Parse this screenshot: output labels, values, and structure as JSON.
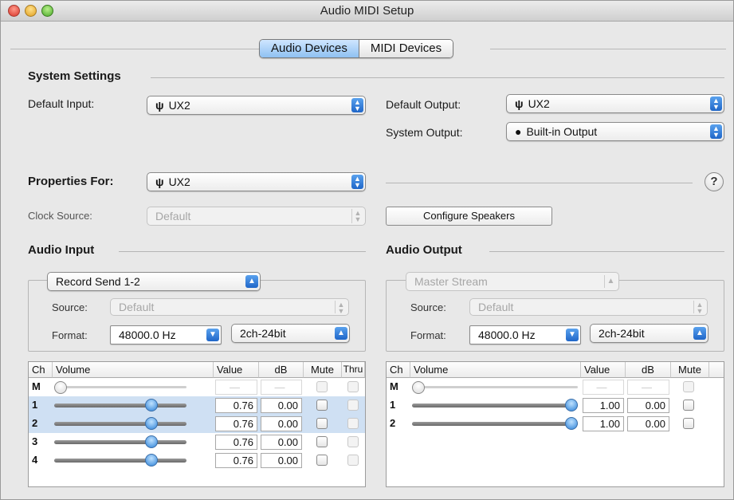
{
  "window": {
    "title": "Audio MIDI Setup"
  },
  "tabs": [
    {
      "label": "Audio Devices",
      "active": true
    },
    {
      "label": "MIDI Devices",
      "active": false
    }
  ],
  "system_settings": {
    "header": "System Settings",
    "default_input_label": "Default Input:",
    "default_input_value": "UX2",
    "default_output_label": "Default Output:",
    "default_output_value": "UX2",
    "system_output_label": "System Output:",
    "system_output_value": "Built-in Output"
  },
  "properties": {
    "label": "Properties For:",
    "value": "UX2",
    "help_label": "?",
    "clock_source_label": "Clock Source:",
    "clock_source_value": "Default",
    "configure_speakers_label": "Configure Speakers"
  },
  "audio_input": {
    "header": "Audio Input",
    "stream": "Record Send 1-2",
    "source_label": "Source:",
    "source_value": "Default",
    "format_label": "Format:",
    "rate": "48000.0 Hz",
    "bits": "2ch-24bit",
    "table": {
      "headers": {
        "ch": "Ch",
        "volume": "Volume",
        "value": "Value",
        "db": "dB",
        "mute": "Mute",
        "thru": "Thru"
      },
      "rows": [
        {
          "ch": "M",
          "value": "—",
          "db": "—",
          "level": 0.0,
          "selected": false,
          "master": true
        },
        {
          "ch": "1",
          "value": "0.76",
          "db": "0.00",
          "level": 0.76,
          "selected": true,
          "master": false
        },
        {
          "ch": "2",
          "value": "0.76",
          "db": "0.00",
          "level": 0.76,
          "selected": true,
          "master": false
        },
        {
          "ch": "3",
          "value": "0.76",
          "db": "0.00",
          "level": 0.76,
          "selected": false,
          "master": false
        },
        {
          "ch": "4",
          "value": "0.76",
          "db": "0.00",
          "level": 0.76,
          "selected": false,
          "master": false
        }
      ]
    }
  },
  "audio_output": {
    "header": "Audio Output",
    "stream": "Master Stream",
    "source_label": "Source:",
    "source_value": "Default",
    "format_label": "Format:",
    "rate": "48000.0 Hz",
    "bits": "2ch-24bit",
    "table": {
      "headers": {
        "ch": "Ch",
        "volume": "Volume",
        "value": "Value",
        "db": "dB",
        "mute": "Mute"
      },
      "rows": [
        {
          "ch": "M",
          "value": "—",
          "db": "—",
          "level": 0.0,
          "selected": false,
          "master": true
        },
        {
          "ch": "1",
          "value": "1.00",
          "db": "0.00",
          "level": 1.0,
          "selected": false,
          "master": false
        },
        {
          "ch": "2",
          "value": "1.00",
          "db": "0.00",
          "level": 1.0,
          "selected": false,
          "master": false
        }
      ]
    }
  },
  "icons": {
    "usb": "usb-icon",
    "apple": "apple-icon",
    "popup_arrows": "updown-arrows-icon"
  },
  "colors": {
    "accent": "#2e82d8",
    "selection": "#cfe0f3"
  }
}
